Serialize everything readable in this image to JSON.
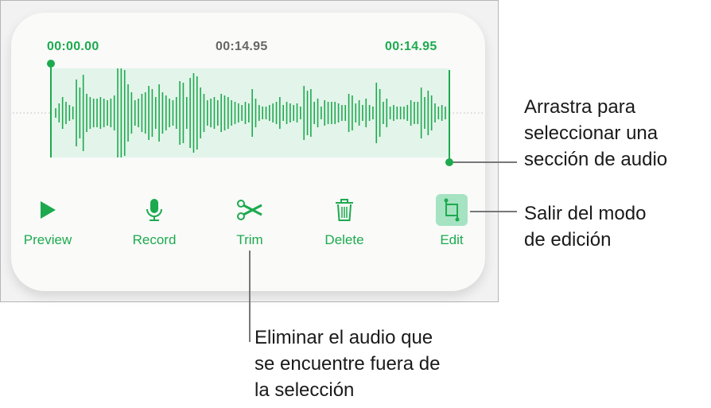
{
  "times": {
    "start": "00:00.00",
    "current": "00:14.95",
    "end": "00:14.95"
  },
  "buttons": [
    {
      "label": "Preview",
      "icon": "play-icon"
    },
    {
      "label": "Record",
      "icon": "microphone-icon"
    },
    {
      "label": "Trim",
      "icon": "scissors-icon"
    },
    {
      "label": "Delete",
      "icon": "trash-icon"
    },
    {
      "label": "Edit",
      "icon": "crop-icon"
    }
  ],
  "callouts": {
    "drag": [
      "Arrastra para",
      "seleccionar una",
      "sección de audio"
    ],
    "exit": [
      "Salir del modo",
      "de edición"
    ],
    "trim": [
      "Eliminar el audio que",
      "se encuentre fuera de",
      "la selección"
    ]
  },
  "colors": {
    "accent": "#1daa4e",
    "selection": "#e3f4ea",
    "edit_bg": "#a5e3c2"
  }
}
